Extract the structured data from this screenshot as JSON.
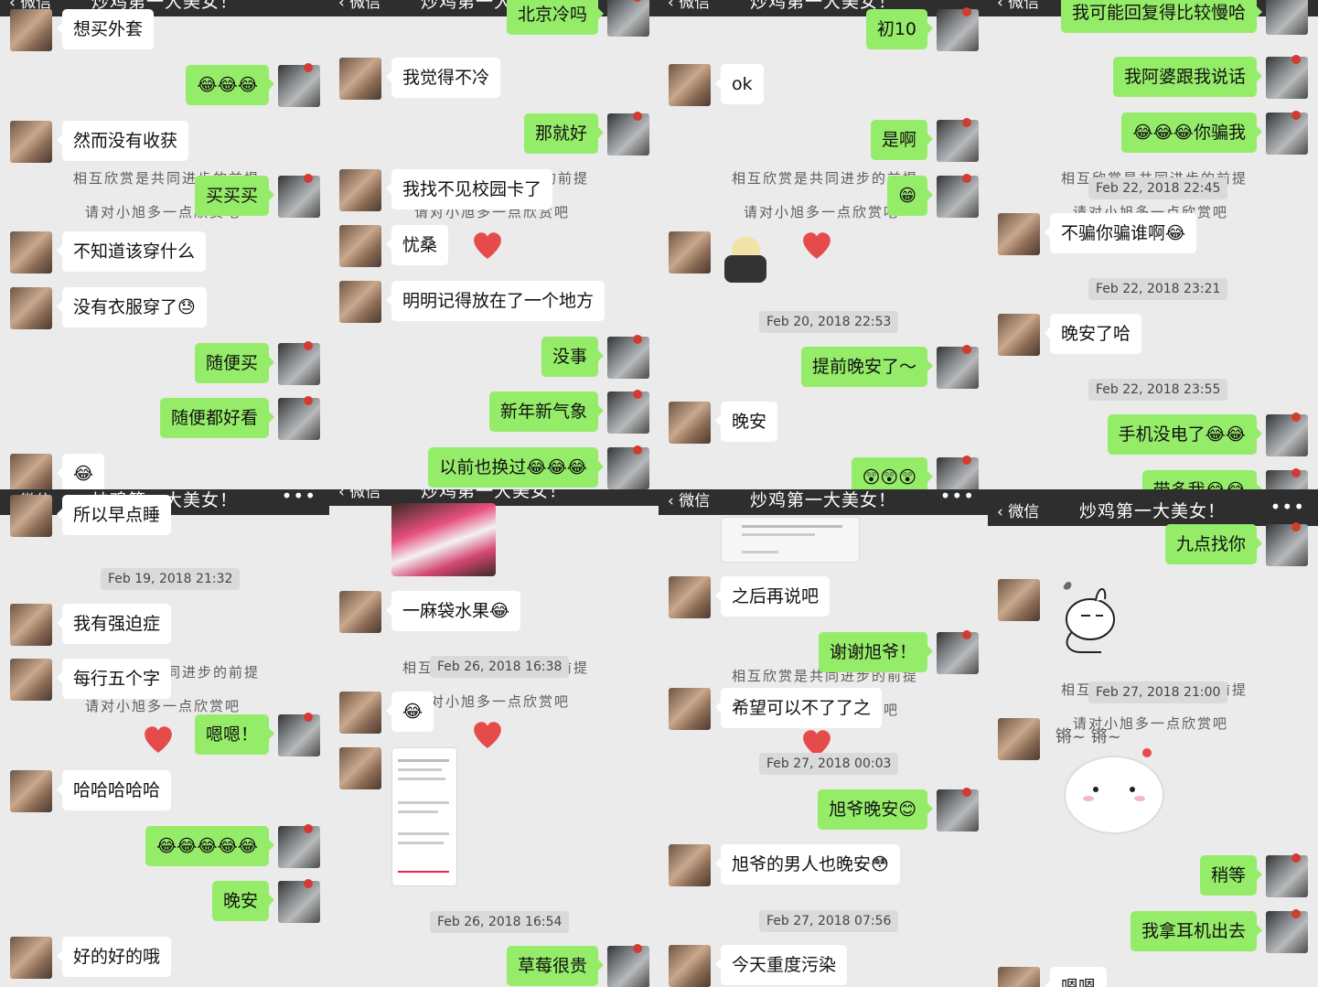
{
  "header": {
    "back_label": "微信",
    "chat_title": "炒鸡第一大美女！",
    "more_label": "•••"
  },
  "watermark": {
    "line1": "相互欣赏是共同进步的前提",
    "line2": "请对小旭多一点欣赏吧"
  },
  "colors": {
    "outgoing_bubble": "#95ec69",
    "incoming_bubble": "#ffffff",
    "chat_background": "#ebebeb",
    "header": "#2e2e2e",
    "heart": "#e64b4b"
  },
  "panels": [
    {
      "messages": [
        {
          "side": "in",
          "text": "想买外套"
        },
        {
          "side": "out",
          "text": "😂😂😂"
        },
        {
          "side": "in",
          "text": "然而没有收获"
        },
        {
          "side": "out",
          "text": "买买买"
        },
        {
          "side": "in",
          "text": "不知道该穿什么"
        },
        {
          "side": "in",
          "text": "没有衣服穿了😓"
        },
        {
          "side": "out",
          "text": "随便买"
        },
        {
          "side": "out",
          "text": "随便都好看"
        },
        {
          "side": "in",
          "text": "😂"
        }
      ]
    },
    {
      "messages": [
        {
          "side": "out",
          "text": "北京冷吗"
        },
        {
          "side": "in",
          "text": "我觉得不冷"
        },
        {
          "side": "out",
          "text": "那就好"
        },
        {
          "side": "in",
          "text": "我找不见校园卡了"
        },
        {
          "side": "in",
          "text": "忧桑"
        },
        {
          "side": "in",
          "text": "明明记得放在了一个地方"
        },
        {
          "side": "out",
          "text": "没事"
        },
        {
          "side": "out",
          "text": "新年新气象"
        },
        {
          "side": "out",
          "text": "以前也换过😂😂😂"
        }
      ]
    },
    {
      "messages": [
        {
          "side": "out",
          "text": "初10"
        },
        {
          "side": "in",
          "text": "ok"
        },
        {
          "side": "out",
          "text": "是啊"
        },
        {
          "side": "out",
          "text": "😁"
        },
        {
          "side": "in",
          "text": ""
        },
        {
          "side": "out",
          "text": "提前晚安了～"
        },
        {
          "side": "in",
          "text": "晚安"
        },
        {
          "side": "out",
          "text": "😲😲😲"
        }
      ],
      "timestamps": [
        "Feb 20, 2018 22:53"
      ]
    },
    {
      "messages": [
        {
          "side": "out",
          "text": "我可能回复得比较慢哈"
        },
        {
          "side": "out",
          "text": "我阿婆跟我说话"
        },
        {
          "side": "out",
          "text": "😂😂😂你骗我"
        },
        {
          "side": "in",
          "text": "不骗你骗谁啊😂"
        },
        {
          "side": "in",
          "text": "晚安了哈"
        },
        {
          "side": "out",
          "text": "手机没电了😂😂"
        },
        {
          "side": "out",
          "text": "带多我😂😂"
        }
      ],
      "timestamps": [
        "Feb 22, 2018 22:45",
        "Feb 22, 2018 23:21",
        "Feb 22, 2018 23:55"
      ]
    },
    {
      "messages": [
        {
          "side": "in",
          "text": "所以早点睡"
        },
        {
          "side": "in",
          "text": "我有强迫症"
        },
        {
          "side": "in",
          "text": "每行五个字"
        },
        {
          "side": "out",
          "text": "嗯嗯！"
        },
        {
          "side": "in",
          "text": "哈哈哈哈哈"
        },
        {
          "side": "out",
          "text": "😂😂😂😂😂"
        },
        {
          "side": "out",
          "text": "晚安"
        },
        {
          "side": "in",
          "text": "好的好的哦"
        }
      ],
      "timestamps": [
        "Feb 19, 2018 21:32"
      ]
    },
    {
      "messages": [
        {
          "side": "in",
          "text": "一麻袋水果😂"
        },
        {
          "side": "in",
          "text": "😂"
        },
        {
          "side": "out",
          "text": "草莓很贵"
        }
      ],
      "timestamps": [
        "Feb 26, 2018 16:38",
        "Feb 26, 2018 16:54"
      ]
    },
    {
      "messages": [
        {
          "side": "in",
          "text": "之后再说吧"
        },
        {
          "side": "out",
          "text": "谢谢旭爷！"
        },
        {
          "side": "in",
          "text": "希望可以不了了之"
        },
        {
          "side": "out",
          "text": "旭爷晚安😊"
        },
        {
          "side": "in",
          "text": "旭爷的男人也晚安😳"
        },
        {
          "side": "in",
          "text": "今天重度污染"
        }
      ],
      "timestamps": [
        "Feb 27, 2018 00:03",
        "Feb 27, 2018 07:56"
      ]
    },
    {
      "messages": [
        {
          "side": "out",
          "text": "九点找你"
        },
        {
          "side": "in",
          "text": ""
        },
        {
          "side": "in",
          "text": ""
        },
        {
          "side": "out",
          "text": "稍等"
        },
        {
          "side": "out",
          "text": "我拿耳机出去"
        },
        {
          "side": "in",
          "text": "嗯嗯"
        }
      ],
      "timestamps": [
        "Feb 27, 2018 21:00"
      ],
      "sticker_text": "锵~ 锵~"
    }
  ]
}
